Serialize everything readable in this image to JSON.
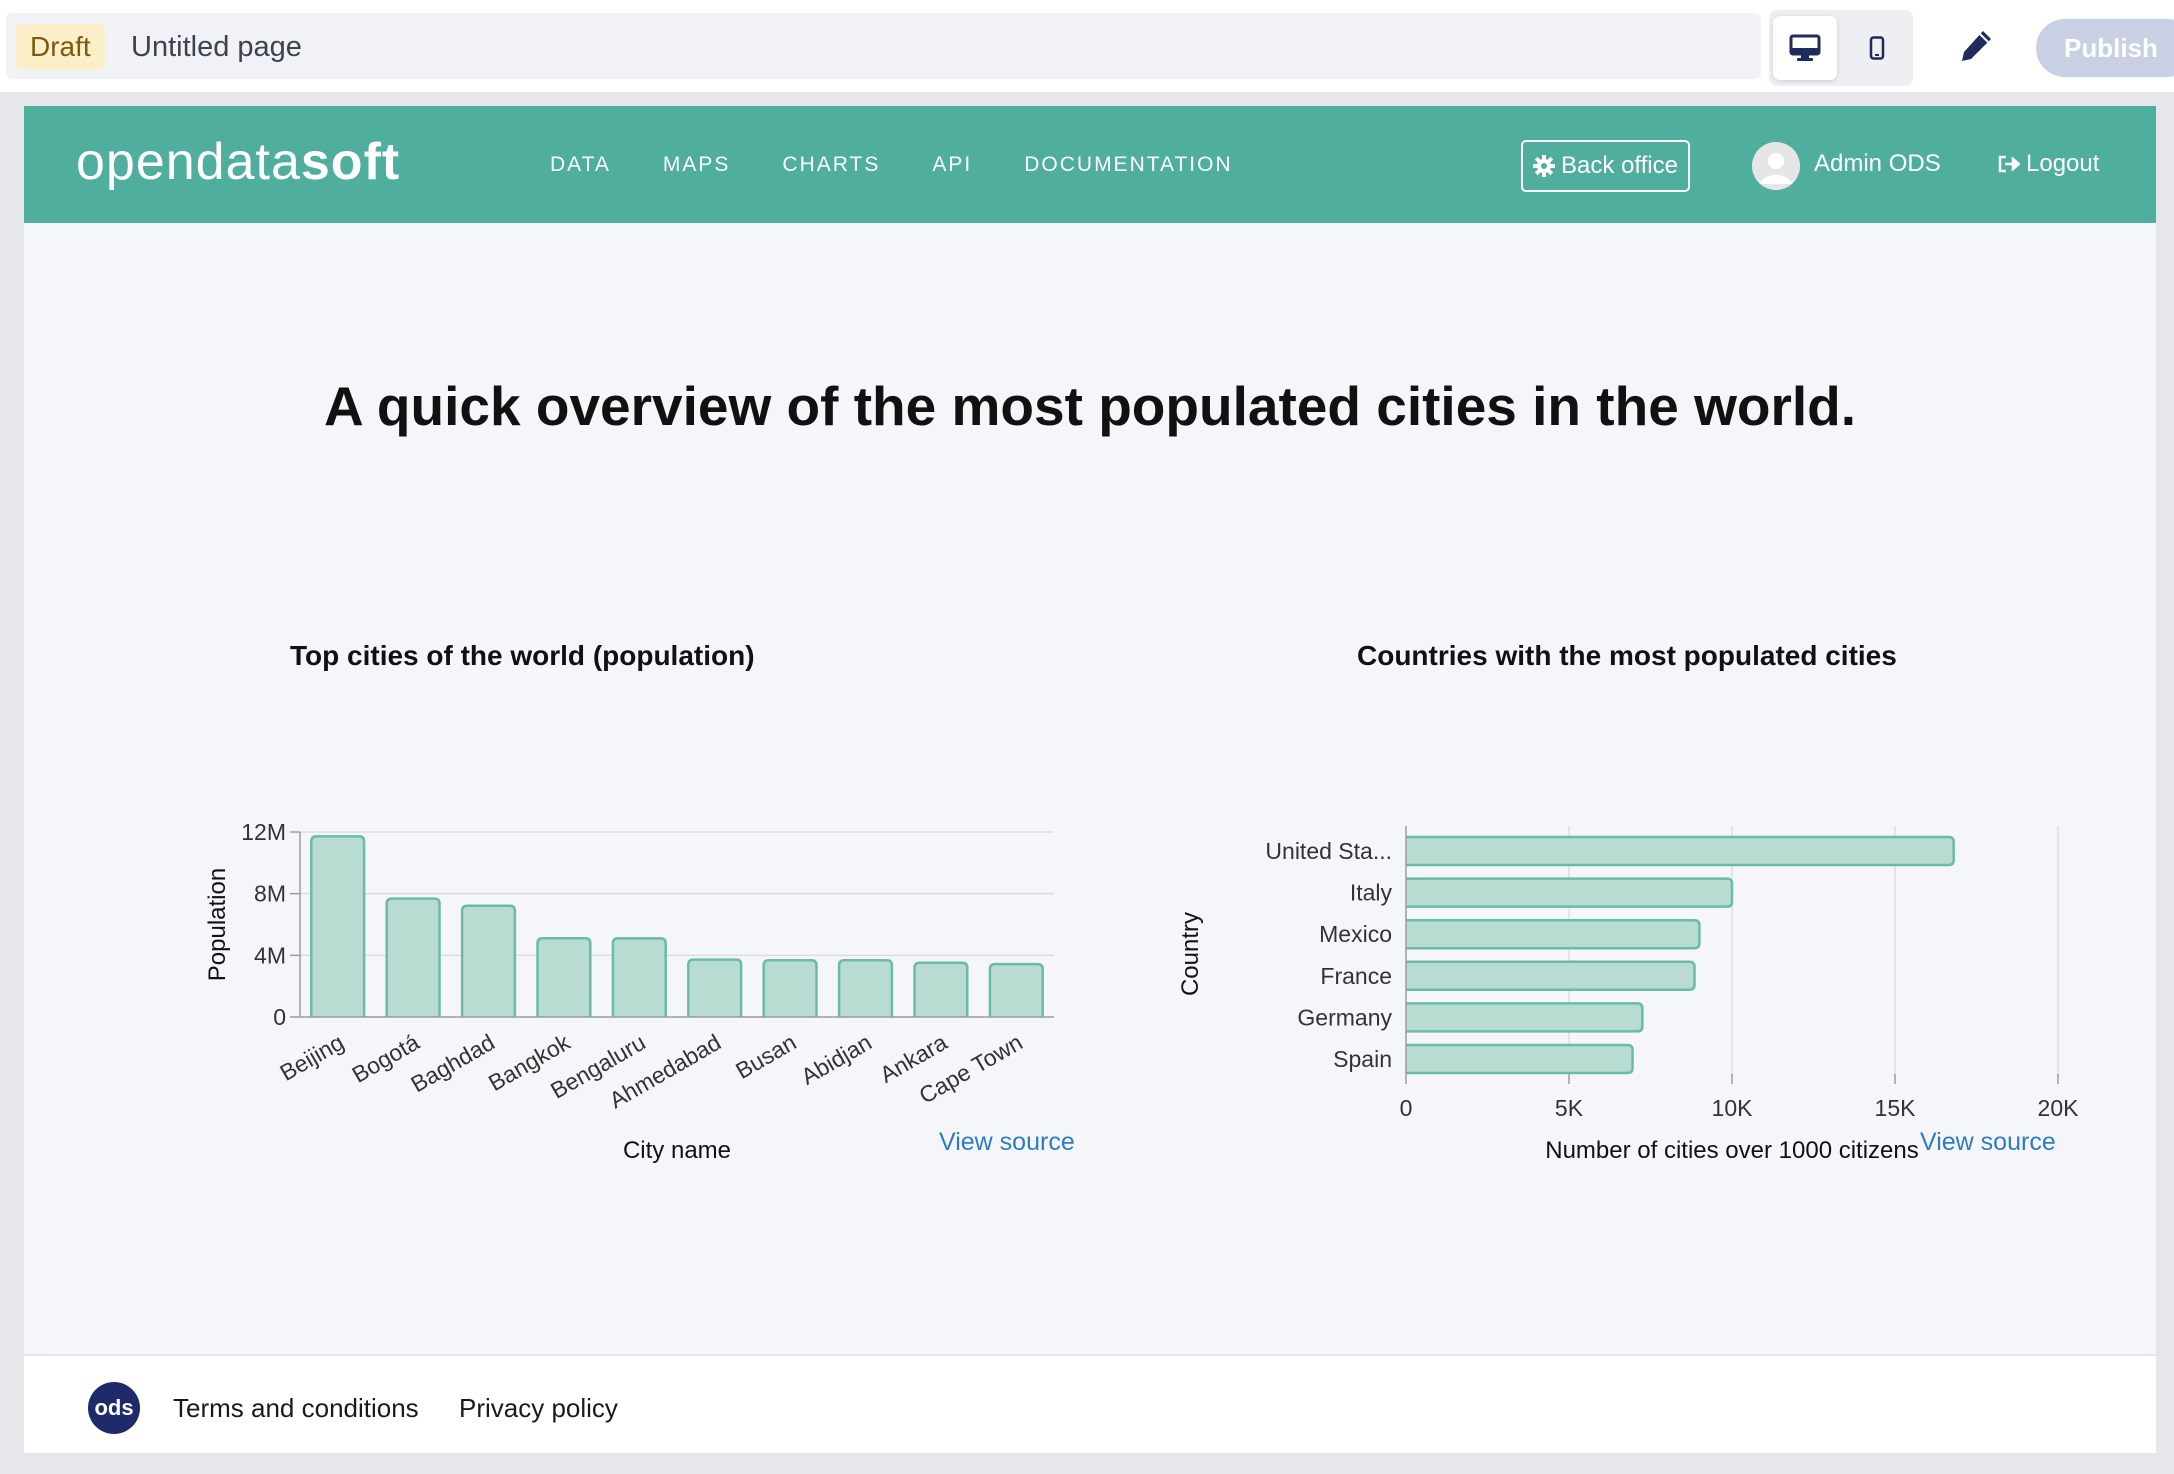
{
  "editor": {
    "status": "Draft",
    "page_title": "Untitled page",
    "publish_label": "Publish",
    "icons": {
      "desktop": "desktop-icon",
      "mobile": "mobile-icon",
      "edit": "pencil-icon"
    }
  },
  "site": {
    "logo_light": "opendata",
    "logo_bold": "soft",
    "nav": [
      "DATA",
      "MAPS",
      "CHARTS",
      "API",
      "DOCUMENTATION"
    ],
    "back_office": "Back office",
    "user_name": "Admin ODS",
    "logout": "Logout",
    "brand_color": "#4fae9e"
  },
  "page": {
    "heading": "A quick overview of the most populated cities in the world.",
    "view_source": "View source"
  },
  "chart_data": [
    {
      "type": "bar",
      "title": "Top cities of the world (population)",
      "xlabel": "City name",
      "ylabel": "Population",
      "categories": [
        "Beijing",
        "Bogotá",
        "Baghdad",
        "Bangkok",
        "Bengaluru",
        "Ahmedabad",
        "Busan",
        "Abidjan",
        "Ankara",
        "Cape Town"
      ],
      "values": [
        11716620,
        7674366,
        7216000,
        5104476,
        5104047,
        3719710,
        3678555,
        3677115,
        3517182,
        3433441
      ],
      "ylim": [
        0,
        12000000
      ],
      "yticks": [
        0,
        4000000,
        8000000,
        12000000
      ],
      "ytick_labels": [
        "0",
        "4M",
        "8M",
        "12M"
      ],
      "grid": true,
      "bar_color": "#b8dcd1",
      "bar_stroke": "#6cbba6"
    },
    {
      "type": "bar",
      "orientation": "horizontal",
      "title": "Countries with the most populated cities",
      "xlabel": "Number of cities over 1000 citizens",
      "ylabel": "Country",
      "categories": [
        "United Sta...",
        "Italy",
        "Mexico",
        "France",
        "Germany",
        "Spain"
      ],
      "values": [
        16800,
        10000,
        9000,
        8850,
        7250,
        6950
      ],
      "xlim": [
        0,
        20000
      ],
      "xticks": [
        0,
        5000,
        10000,
        15000,
        20000
      ],
      "xtick_labels": [
        "0",
        "5K",
        "10K",
        "15K",
        "20K"
      ],
      "grid": true,
      "bar_color": "#b8dcd1",
      "bar_stroke": "#6cbba6"
    }
  ],
  "footer": {
    "badge": "ods",
    "terms": "Terms and conditions",
    "privacy": "Privacy policy"
  }
}
